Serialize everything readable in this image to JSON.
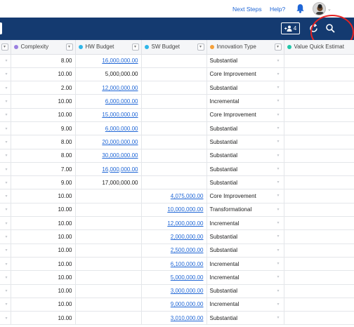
{
  "topbar": {
    "next_steps": "Next Steps",
    "help": "Help?"
  },
  "navbar": {
    "member_count": "4"
  },
  "columns": [
    {
      "label": "",
      "dot": ""
    },
    {
      "label": "Complexity",
      "dot": "#9a7fe0"
    },
    {
      "label": "HW Budget",
      "dot": "#2fb6e8"
    },
    {
      "label": "SW Budget",
      "dot": "#2fb6e8"
    },
    {
      "label": "Innovation Type",
      "dot": "#f5a03a"
    },
    {
      "label": "Value Quick Estimat",
      "dot": "#21c6a8"
    }
  ],
  "rows": [
    {
      "complexity": "8.00",
      "hw": "16,000,000.00",
      "hw_link": true,
      "sw": "",
      "sw_link": false,
      "type": "Substantial"
    },
    {
      "complexity": "10.00",
      "hw": "5,000,000.00",
      "hw_link": false,
      "sw": "",
      "sw_link": false,
      "type": "Core Improvement"
    },
    {
      "complexity": "2.00",
      "hw": "12,000,000.00",
      "hw_link": true,
      "sw": "",
      "sw_link": false,
      "type": "Substantial"
    },
    {
      "complexity": "10.00",
      "hw": "6,000,000.00",
      "hw_link": true,
      "sw": "",
      "sw_link": false,
      "type": "Incremental"
    },
    {
      "complexity": "10.00",
      "hw": "15,000,000.00",
      "hw_link": true,
      "sw": "",
      "sw_link": false,
      "type": "Core Improvement"
    },
    {
      "complexity": "9.00",
      "hw": "6,000,000.00",
      "hw_link": true,
      "sw": "",
      "sw_link": false,
      "type": "Substantial"
    },
    {
      "complexity": "8.00",
      "hw": "20,000,000.00",
      "hw_link": true,
      "sw": "",
      "sw_link": false,
      "type": "Substantial"
    },
    {
      "complexity": "8.00",
      "hw": "30,000,000.00",
      "hw_link": true,
      "sw": "",
      "sw_link": false,
      "type": "Substantial"
    },
    {
      "complexity": "7.00",
      "hw": "16,000,000.00",
      "hw_link": true,
      "sw": "",
      "sw_link": false,
      "type": "Substantial"
    },
    {
      "complexity": "9.00",
      "hw": "17,000,000.00",
      "hw_link": false,
      "sw": "",
      "sw_link": false,
      "type": "Substantial"
    },
    {
      "complexity": "10.00",
      "hw": "",
      "hw_link": false,
      "sw": "4,075,000.00",
      "sw_link": true,
      "type": "Core Improvement"
    },
    {
      "complexity": "10.00",
      "hw": "",
      "hw_link": false,
      "sw": "10,000,000.00",
      "sw_link": true,
      "type": "Transformational"
    },
    {
      "complexity": "10.00",
      "hw": "",
      "hw_link": false,
      "sw": "12,000,000.00",
      "sw_link": true,
      "type": "Incremental"
    },
    {
      "complexity": "10.00",
      "hw": "",
      "hw_link": false,
      "sw": "2,000,000.00",
      "sw_link": true,
      "type": "Substantial"
    },
    {
      "complexity": "10.00",
      "hw": "",
      "hw_link": false,
      "sw": "2,500,000.00",
      "sw_link": true,
      "type": "Substantial"
    },
    {
      "complexity": "10.00",
      "hw": "",
      "hw_link": false,
      "sw": "6,100,000.00",
      "sw_link": true,
      "type": "Incremental"
    },
    {
      "complexity": "10.00",
      "hw": "",
      "hw_link": false,
      "sw": "5,000,000.00",
      "sw_link": true,
      "type": "Incremental"
    },
    {
      "complexity": "10.00",
      "hw": "",
      "hw_link": false,
      "sw": "3,000,000.00",
      "sw_link": true,
      "type": "Substantial"
    },
    {
      "complexity": "10.00",
      "hw": "",
      "hw_link": false,
      "sw": "9,000,000.00",
      "sw_link": true,
      "type": "Incremental"
    },
    {
      "complexity": "10.00",
      "hw": "",
      "hw_link": false,
      "sw": "3,010,000.00",
      "sw_link": true,
      "type": "Substantial"
    }
  ],
  "colors": {
    "navbar": "#143a70",
    "link": "#1f66d6",
    "highlight": "#e52222"
  },
  "icons": {
    "notifications": "bell-icon",
    "members": "add-person-icon",
    "refresh": "refresh-icon",
    "search": "search-icon"
  }
}
